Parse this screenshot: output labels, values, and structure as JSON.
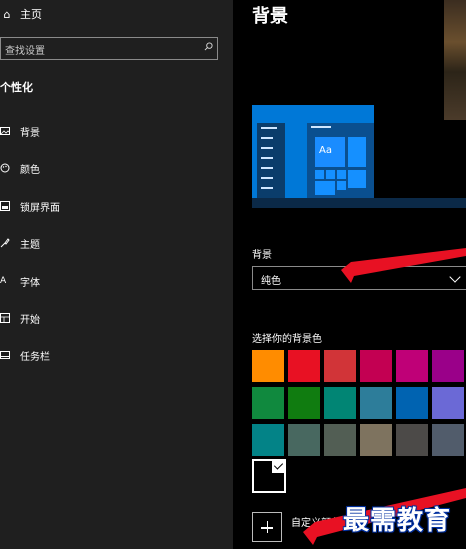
{
  "sidebar": {
    "home": {
      "label": "主页",
      "icon": "home-icon"
    },
    "search": {
      "placeholder": "查找设置",
      "icon": "search-icon"
    },
    "section_title": "个性化",
    "items": [
      {
        "label": "背景",
        "icon": "image-icon"
      },
      {
        "label": "颜色",
        "icon": "palette-icon"
      },
      {
        "label": "锁屏界面",
        "icon": "lock-screen-icon"
      },
      {
        "label": "主题",
        "icon": "theme-icon"
      },
      {
        "label": "字体",
        "icon": "font-icon"
      },
      {
        "label": "开始",
        "icon": "start-icon"
      },
      {
        "label": "任务栏",
        "icon": "taskbar-icon"
      }
    ]
  },
  "main": {
    "title": "背景",
    "preview": {
      "tile_text": "Aa"
    },
    "background_field": {
      "label": "背景",
      "value": "纯色"
    },
    "color_picker": {
      "label": "选择你的背景色",
      "swatches": [
        "#ff8c00",
        "#e81123",
        "#d13438",
        "#c30052",
        "#bf0077",
        "#9a0089",
        "#10893e",
        "#107c10",
        "#018574",
        "#2d7d9a",
        "#0063b1",
        "#6b69d6",
        "#038387",
        "#486860",
        "#525e54",
        "#7e735f",
        "#4c4a48",
        "#515c6b"
      ],
      "selected_swatch": "#000000"
    },
    "custom_color": {
      "label": "自定义颜色"
    },
    "watermark": "最需教育"
  },
  "colors": {
    "accent": "#0078d7",
    "arrow": "#e81123"
  }
}
